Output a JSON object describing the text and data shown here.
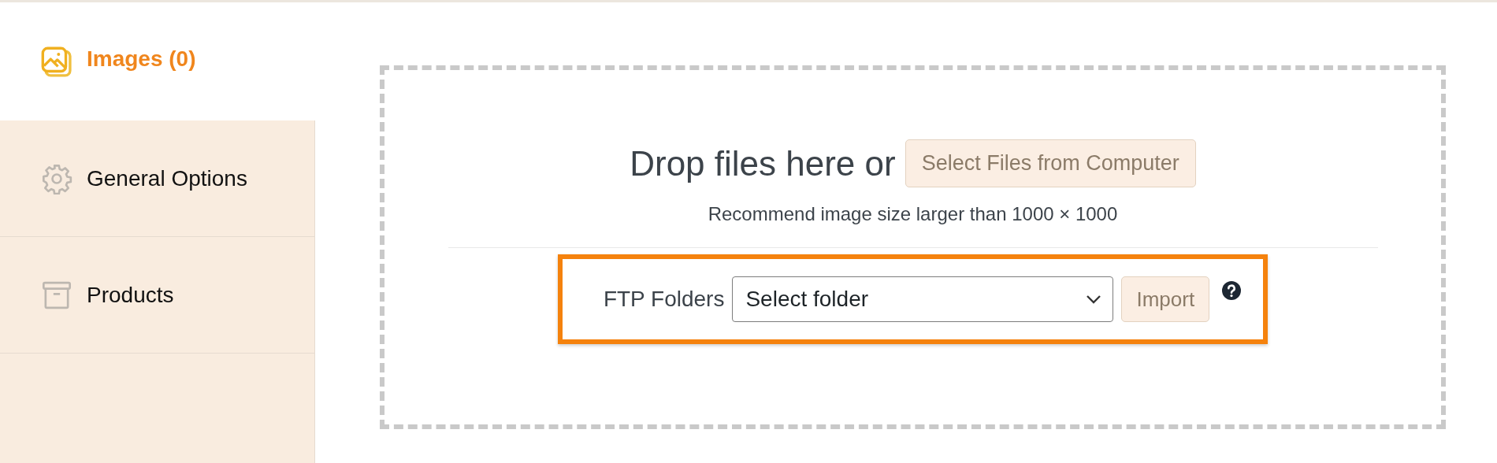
{
  "sidebar": {
    "items": [
      {
        "label": "Images (0)",
        "selected": true
      },
      {
        "label": "General Options",
        "selected": false
      },
      {
        "label": "Products",
        "selected": false
      }
    ]
  },
  "dropzone": {
    "prompt": "Drop files here or",
    "button": "Select Files from Computer",
    "hint": "Recommend image size larger than 1000 × 1000"
  },
  "ftp": {
    "label": "FTP Folders",
    "select": {
      "value": "Select folder"
    },
    "button": "Import",
    "highlighted": true
  }
}
